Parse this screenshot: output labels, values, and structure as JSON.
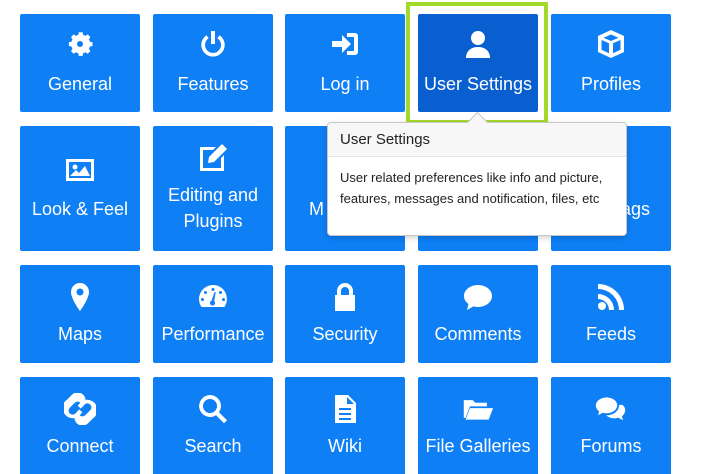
{
  "tiles": [
    {
      "label": "General",
      "icon": "gear-icon"
    },
    {
      "label": "Features",
      "icon": "power-icon"
    },
    {
      "label": "Log in",
      "icon": "sign-in-icon"
    },
    {
      "label": "User Settings",
      "icon": "user-icon"
    },
    {
      "label": "Profiles",
      "icon": "cube-icon"
    },
    {
      "label": "Look & Feel",
      "icon": "image-icon"
    },
    {
      "label": "Editing and Plugins",
      "icon": "edit-icon"
    },
    {
      "label": "M",
      "icon": ""
    },
    {
      "label": "",
      "icon": ""
    },
    {
      "label": "ags",
      "icon": ""
    },
    {
      "label": "Maps",
      "icon": "map-marker-icon"
    },
    {
      "label": "Performance",
      "icon": "dashboard-icon"
    },
    {
      "label": "Security",
      "icon": "lock-icon"
    },
    {
      "label": "Comments",
      "icon": "comment-icon"
    },
    {
      "label": "Feeds",
      "icon": "rss-icon"
    },
    {
      "label": "Connect",
      "icon": "link-icon"
    },
    {
      "label": "Search",
      "icon": "search-icon"
    },
    {
      "label": "Wiki",
      "icon": "file-text-icon"
    },
    {
      "label": "File Galleries",
      "icon": "folder-open-icon"
    },
    {
      "label": "Forums",
      "icon": "comments-icon"
    }
  ],
  "tooltip": {
    "title": "User Settings",
    "body": "User related preferences like info and picture, features, messages and notification, files, etc"
  },
  "colors": {
    "tile": "#0e7ff5",
    "tile_active": "#0a5fd0",
    "highlight": "#a3d92a"
  }
}
